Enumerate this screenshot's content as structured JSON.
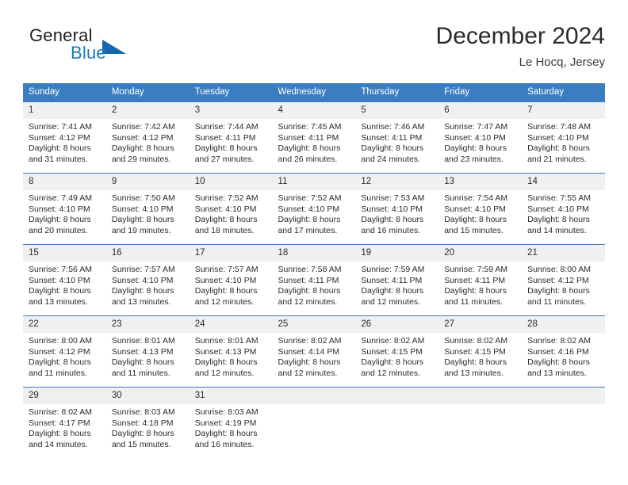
{
  "brand": {
    "name_top": "General",
    "name_bottom": "Blue",
    "logo_icon": "triangle-logo-icon",
    "accent_color": "#1878c0"
  },
  "header": {
    "title": "December 2024",
    "subtitle": "Le Hocq, Jersey"
  },
  "theme": {
    "header_bg": "#3a7dc0",
    "daynum_bg": "#f0f0f0",
    "text_color": "#2b2b2b"
  },
  "calendar": {
    "weekday_headers": [
      "Sunday",
      "Monday",
      "Tuesday",
      "Wednesday",
      "Thursday",
      "Friday",
      "Saturday"
    ],
    "weeks": [
      [
        {
          "day": "1",
          "sunrise": "Sunrise: 7:41 AM",
          "sunset": "Sunset: 4:12 PM",
          "daylight1": "Daylight: 8 hours",
          "daylight2": "and 31 minutes."
        },
        {
          "day": "2",
          "sunrise": "Sunrise: 7:42 AM",
          "sunset": "Sunset: 4:12 PM",
          "daylight1": "Daylight: 8 hours",
          "daylight2": "and 29 minutes."
        },
        {
          "day": "3",
          "sunrise": "Sunrise: 7:44 AM",
          "sunset": "Sunset: 4:11 PM",
          "daylight1": "Daylight: 8 hours",
          "daylight2": "and 27 minutes."
        },
        {
          "day": "4",
          "sunrise": "Sunrise: 7:45 AM",
          "sunset": "Sunset: 4:11 PM",
          "daylight1": "Daylight: 8 hours",
          "daylight2": "and 26 minutes."
        },
        {
          "day": "5",
          "sunrise": "Sunrise: 7:46 AM",
          "sunset": "Sunset: 4:11 PM",
          "daylight1": "Daylight: 8 hours",
          "daylight2": "and 24 minutes."
        },
        {
          "day": "6",
          "sunrise": "Sunrise: 7:47 AM",
          "sunset": "Sunset: 4:10 PM",
          "daylight1": "Daylight: 8 hours",
          "daylight2": "and 23 minutes."
        },
        {
          "day": "7",
          "sunrise": "Sunrise: 7:48 AM",
          "sunset": "Sunset: 4:10 PM",
          "daylight1": "Daylight: 8 hours",
          "daylight2": "and 21 minutes."
        }
      ],
      [
        {
          "day": "8",
          "sunrise": "Sunrise: 7:49 AM",
          "sunset": "Sunset: 4:10 PM",
          "daylight1": "Daylight: 8 hours",
          "daylight2": "and 20 minutes."
        },
        {
          "day": "9",
          "sunrise": "Sunrise: 7:50 AM",
          "sunset": "Sunset: 4:10 PM",
          "daylight1": "Daylight: 8 hours",
          "daylight2": "and 19 minutes."
        },
        {
          "day": "10",
          "sunrise": "Sunrise: 7:52 AM",
          "sunset": "Sunset: 4:10 PM",
          "daylight1": "Daylight: 8 hours",
          "daylight2": "and 18 minutes."
        },
        {
          "day": "11",
          "sunrise": "Sunrise: 7:52 AM",
          "sunset": "Sunset: 4:10 PM",
          "daylight1": "Daylight: 8 hours",
          "daylight2": "and 17 minutes."
        },
        {
          "day": "12",
          "sunrise": "Sunrise: 7:53 AM",
          "sunset": "Sunset: 4:10 PM",
          "daylight1": "Daylight: 8 hours",
          "daylight2": "and 16 minutes."
        },
        {
          "day": "13",
          "sunrise": "Sunrise: 7:54 AM",
          "sunset": "Sunset: 4:10 PM",
          "daylight1": "Daylight: 8 hours",
          "daylight2": "and 15 minutes."
        },
        {
          "day": "14",
          "sunrise": "Sunrise: 7:55 AM",
          "sunset": "Sunset: 4:10 PM",
          "daylight1": "Daylight: 8 hours",
          "daylight2": "and 14 minutes."
        }
      ],
      [
        {
          "day": "15",
          "sunrise": "Sunrise: 7:56 AM",
          "sunset": "Sunset: 4:10 PM",
          "daylight1": "Daylight: 8 hours",
          "daylight2": "and 13 minutes."
        },
        {
          "day": "16",
          "sunrise": "Sunrise: 7:57 AM",
          "sunset": "Sunset: 4:10 PM",
          "daylight1": "Daylight: 8 hours",
          "daylight2": "and 13 minutes."
        },
        {
          "day": "17",
          "sunrise": "Sunrise: 7:57 AM",
          "sunset": "Sunset: 4:10 PM",
          "daylight1": "Daylight: 8 hours",
          "daylight2": "and 12 minutes."
        },
        {
          "day": "18",
          "sunrise": "Sunrise: 7:58 AM",
          "sunset": "Sunset: 4:11 PM",
          "daylight1": "Daylight: 8 hours",
          "daylight2": "and 12 minutes."
        },
        {
          "day": "19",
          "sunrise": "Sunrise: 7:59 AM",
          "sunset": "Sunset: 4:11 PM",
          "daylight1": "Daylight: 8 hours",
          "daylight2": "and 12 minutes."
        },
        {
          "day": "20",
          "sunrise": "Sunrise: 7:59 AM",
          "sunset": "Sunset: 4:11 PM",
          "daylight1": "Daylight: 8 hours",
          "daylight2": "and 11 minutes."
        },
        {
          "day": "21",
          "sunrise": "Sunrise: 8:00 AM",
          "sunset": "Sunset: 4:12 PM",
          "daylight1": "Daylight: 8 hours",
          "daylight2": "and 11 minutes."
        }
      ],
      [
        {
          "day": "22",
          "sunrise": "Sunrise: 8:00 AM",
          "sunset": "Sunset: 4:12 PM",
          "daylight1": "Daylight: 8 hours",
          "daylight2": "and 11 minutes."
        },
        {
          "day": "23",
          "sunrise": "Sunrise: 8:01 AM",
          "sunset": "Sunset: 4:13 PM",
          "daylight1": "Daylight: 8 hours",
          "daylight2": "and 11 minutes."
        },
        {
          "day": "24",
          "sunrise": "Sunrise: 8:01 AM",
          "sunset": "Sunset: 4:13 PM",
          "daylight1": "Daylight: 8 hours",
          "daylight2": "and 12 minutes."
        },
        {
          "day": "25",
          "sunrise": "Sunrise: 8:02 AM",
          "sunset": "Sunset: 4:14 PM",
          "daylight1": "Daylight: 8 hours",
          "daylight2": "and 12 minutes."
        },
        {
          "day": "26",
          "sunrise": "Sunrise: 8:02 AM",
          "sunset": "Sunset: 4:15 PM",
          "daylight1": "Daylight: 8 hours",
          "daylight2": "and 12 minutes."
        },
        {
          "day": "27",
          "sunrise": "Sunrise: 8:02 AM",
          "sunset": "Sunset: 4:15 PM",
          "daylight1": "Daylight: 8 hours",
          "daylight2": "and 13 minutes."
        },
        {
          "day": "28",
          "sunrise": "Sunrise: 8:02 AM",
          "sunset": "Sunset: 4:16 PM",
          "daylight1": "Daylight: 8 hours",
          "daylight2": "and 13 minutes."
        }
      ],
      [
        {
          "day": "29",
          "sunrise": "Sunrise: 8:02 AM",
          "sunset": "Sunset: 4:17 PM",
          "daylight1": "Daylight: 8 hours",
          "daylight2": "and 14 minutes."
        },
        {
          "day": "30",
          "sunrise": "Sunrise: 8:03 AM",
          "sunset": "Sunset: 4:18 PM",
          "daylight1": "Daylight: 8 hours",
          "daylight2": "and 15 minutes."
        },
        {
          "day": "31",
          "sunrise": "Sunrise: 8:03 AM",
          "sunset": "Sunset: 4:19 PM",
          "daylight1": "Daylight: 8 hours",
          "daylight2": "and 16 minutes."
        },
        {
          "day": "",
          "sunrise": "",
          "sunset": "",
          "daylight1": "",
          "daylight2": ""
        },
        {
          "day": "",
          "sunrise": "",
          "sunset": "",
          "daylight1": "",
          "daylight2": ""
        },
        {
          "day": "",
          "sunrise": "",
          "sunset": "",
          "daylight1": "",
          "daylight2": ""
        },
        {
          "day": "",
          "sunrise": "",
          "sunset": "",
          "daylight1": "",
          "daylight2": ""
        }
      ]
    ]
  }
}
